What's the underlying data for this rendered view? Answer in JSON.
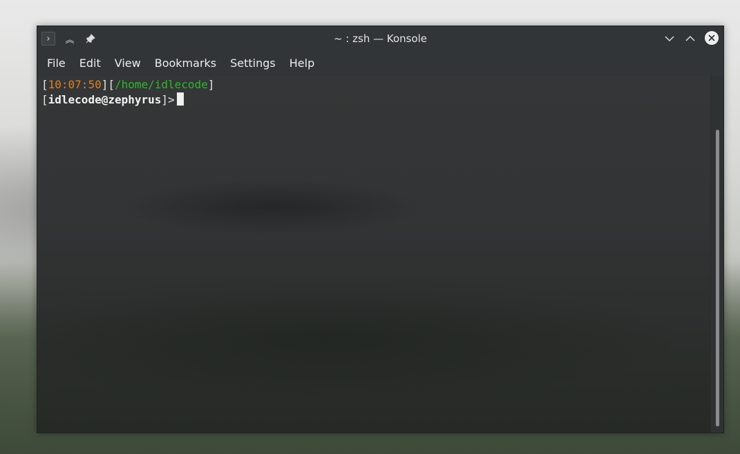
{
  "window": {
    "title": "~ : zsh — Konsole"
  },
  "titlebar": {
    "app_icon_glyph": "›",
    "keep_above_glyph": "︽",
    "pin_glyph": "✎",
    "minimize_glyph": "⌄",
    "maximize_glyph": "⌃",
    "close_glyph": "✕"
  },
  "menubar": {
    "items": [
      "File",
      "Edit",
      "View",
      "Bookmarks",
      "Settings",
      "Help"
    ]
  },
  "terminal": {
    "line1": {
      "open1": "[",
      "time": "10:07:50",
      "mid": "][",
      "path": "/home/idlecode",
      "close": "]"
    },
    "line2": {
      "open": "[",
      "user_host": "idlecode@zephyrus",
      "close": "]>"
    }
  },
  "colors": {
    "time": "#e67e22",
    "path": "#2eb82e",
    "window_bg": "#323537"
  }
}
